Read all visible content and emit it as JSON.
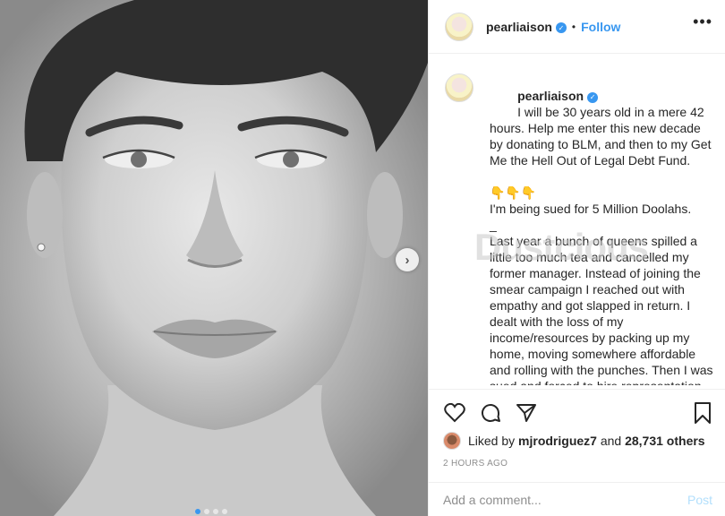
{
  "post": {
    "username": "pearliaison",
    "follow_label": "Follow",
    "bullet": "•",
    "more_label": "•••",
    "next_label": "›",
    "watermark": "Dustcious"
  },
  "caption": {
    "username": "pearliaison",
    "text1": "I will be 30 years old in a mere 42 hours. Help me enter this new decade by donating to BLM, and then to my Get Me the Hell Out of Legal Debt Fund.",
    "emoji": "👇👇👇",
    "text2": "I'm being sued for 5 Million Doolahs.",
    "separator": "_",
    "text3": "Last year a bunch of queens spilled a little too much tea and cancelled my former manager. Instead of joining the smear campaign I reached out with empathy and got slapped in return. I dealt with the loss of my income/resources by packing up my home, moving somewhere affordable and rolling with the punches. Then I was sued and forced to hire representation in this lawsuit."
  },
  "likes": {
    "prefix": "Liked by",
    "user": "mjrodriguez7",
    "and": "and",
    "count": "28,731 others"
  },
  "timestamp": "2 HOURS AGO",
  "comment": {
    "placeholder": "Add a comment...",
    "post_label": "Post"
  },
  "carousel": {
    "total": 4,
    "active": 1
  },
  "colors": {
    "accent": "#3897f0",
    "muted": "#8e8e8e",
    "post_disabled": "#b2dffc"
  }
}
